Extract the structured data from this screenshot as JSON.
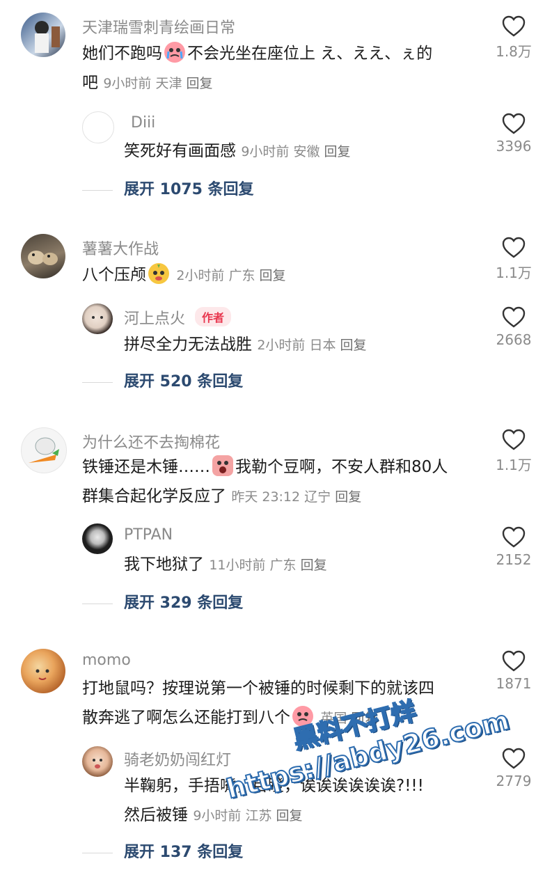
{
  "threads": [
    {
      "main": {
        "username": "天津瑞雪刺青绘画日常",
        "text_line1_a": "她们不跑吗",
        "text_line1_b": "不会光坐在座位上 え、ええ、ぇ的",
        "text_line2": "吧",
        "emoji": "crying-face-icon",
        "time": "9小时前",
        "location": "天津",
        "reply_label": "回复",
        "likes": "1.8万"
      },
      "sub": {
        "username": "Diii",
        "text": "笑死好有画面感",
        "time": "9小时前",
        "location": "安徽",
        "reply_label": "回复",
        "likes": "3396"
      },
      "expand": "展开 1075 条回复"
    },
    {
      "main": {
        "username": "薯薯大作战",
        "text": "八个压颅",
        "emoji": "pear-face-icon",
        "time": "2小时前",
        "location": "广东",
        "reply_label": "回复",
        "likes": "1.1万"
      },
      "sub": {
        "username": "河上点火",
        "badge": "作者",
        "text": "拼尽全力无法战胜",
        "time": "2小时前",
        "location": "日本",
        "reply_label": "回复",
        "likes": "2668"
      },
      "expand": "展开 520 条回复"
    },
    {
      "main": {
        "username": "为什么还不去掏棉花",
        "text_line1_a": "铁锤还是木锤……",
        "text_line1_b": "我勒个豆啊，不安人群和80人",
        "text_line2": "群集合起化学反应了",
        "emoji": "screaming-face-icon",
        "time": "昨天 23:12",
        "location": "辽宁",
        "reply_label": "回复",
        "likes": "1.1万"
      },
      "sub": {
        "username": "PTPAN",
        "text": "我下地狱了",
        "time": "11小时前",
        "location": "广东",
        "reply_label": "回复",
        "likes": "2152"
      },
      "expand": "展开 329 条回复"
    },
    {
      "main": {
        "username": "momo",
        "text_line1": "打地鼠吗？按理说第一个被锤的时候剩下的就该四",
        "text_line2": "散奔逃了啊怎么还能打到八个",
        "emoji": "crying-face-icon",
        "location": "英国",
        "reply_label": "回复",
        "likes": "1871"
      },
      "sub": {
        "username": "骑老奶奶闯红灯",
        "text_line1": "半鞠躬，手捂嘴，目瞪，诶诶诶诶诶诶?!!!",
        "text_line2": "然后被锤",
        "time": "9小时前",
        "location": "江苏",
        "reply_label": "回复",
        "likes": "2779"
      },
      "expand": "展开 137 条回复"
    }
  ],
  "watermark": {
    "line1": "黑料不打烊",
    "line2": "https://abdy26.com"
  },
  "colors": {
    "username": "#8a8a8a",
    "expand": "#2c4a70",
    "author_badge": "#e8364e"
  }
}
